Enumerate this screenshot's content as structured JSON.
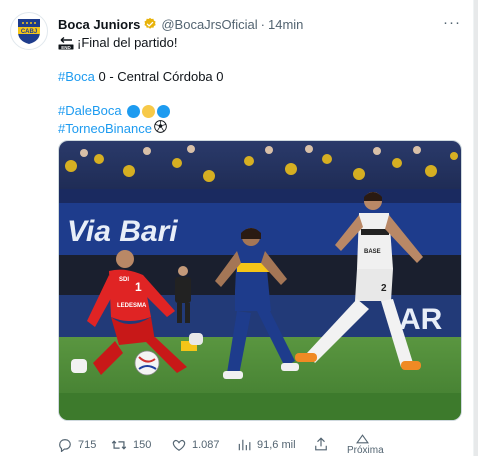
{
  "tweet": {
    "author_name": "Boca Juniors",
    "handle": "@BocaJrsOficial",
    "separator": "·",
    "time": "14min",
    "avatar_text": "CABJ",
    "text_line1": "¡Final del partido!",
    "score_tag": "#Boca",
    "score_rest": " 0 - Central Córdoba 0",
    "hashtag1": "#DaleBoca",
    "hashtag2": "#TorneoBinance",
    "more_label": "···",
    "emoji_circles": [
      "#1d9bf0",
      "#f7c948",
      "#1d9bf0"
    ]
  },
  "media": {
    "banner_text": "Via Bari",
    "banner_text2": "AR",
    "keeper_number": "1",
    "keeper_sponsor": "LEDESMA",
    "keeper_brand": "SDI",
    "rival_number": "2",
    "rival_sponsor": "BASE"
  },
  "actions": {
    "replies": "715",
    "retweets": "150",
    "likes": "1.087",
    "views": "91,6 mil",
    "next_label": "Próxima"
  },
  "colors": {
    "accent": "#1d9bf0",
    "boca_blue": "#1e3c8c",
    "boca_gold": "#f5c518",
    "grass": "#4f8a3a",
    "keeper_red": "#e02424"
  }
}
